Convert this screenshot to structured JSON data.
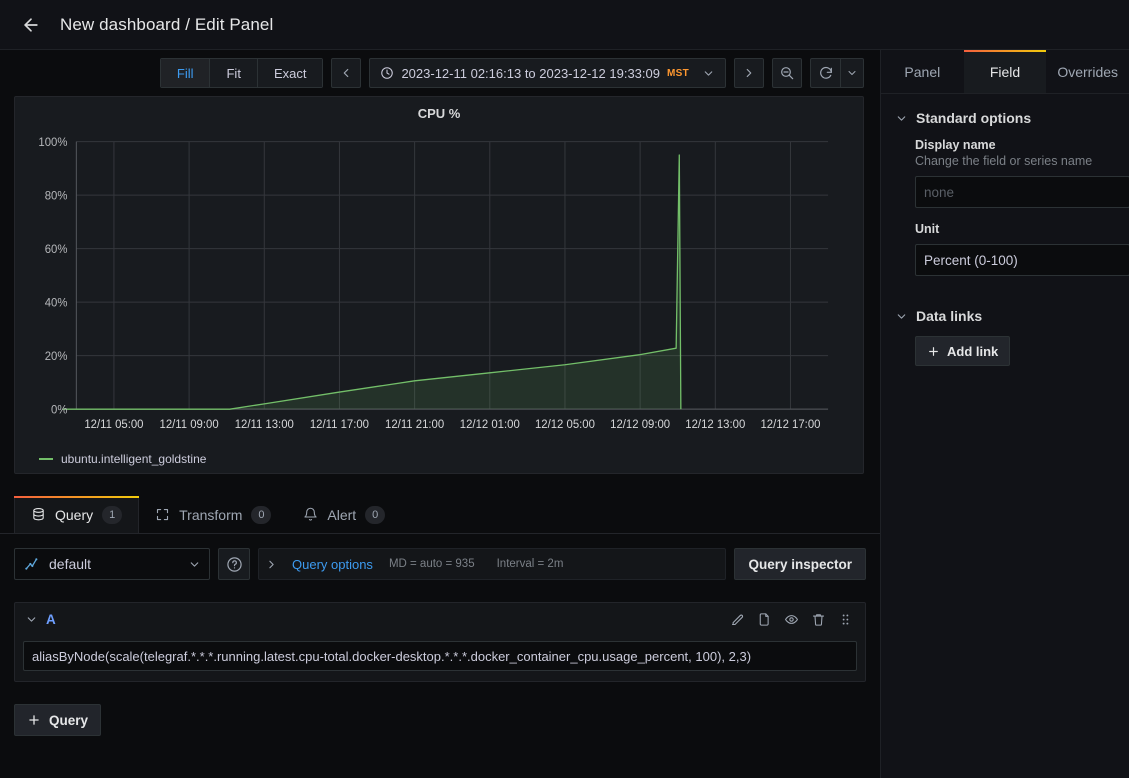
{
  "header": {
    "back_icon": "arrow-left-icon",
    "title": "New dashboard / Edit Panel"
  },
  "toolbar": {
    "sizing_options": [
      {
        "label": "Fill",
        "active": true
      },
      {
        "label": "Fit",
        "active": false
      },
      {
        "label": "Exact",
        "active": false
      }
    ],
    "prev_range_icon": "chevron-left-icon",
    "next_range_icon": "chevron-right-icon",
    "clock_icon": "clock-icon",
    "time_range": "2023-12-11 02:16:13 to 2023-12-12 19:33:09",
    "timezone": "MST",
    "time_caret_icon": "chevron-down-icon",
    "zoom_out_icon": "zoom-out-icon",
    "refresh_icon": "refresh-icon",
    "refresh_caret_icon": "chevron-down-icon"
  },
  "panel": {
    "title": "CPU %",
    "legend": [
      {
        "label": "ubuntu.intelligent_goldstine",
        "color": "#73bf69"
      }
    ]
  },
  "chart_data": {
    "type": "area",
    "title": "CPU %",
    "xlabel": "",
    "ylabel": "",
    "ylim": [
      0,
      100
    ],
    "y_ticks": [
      "0%",
      "20%",
      "40%",
      "60%",
      "80%",
      "100%"
    ],
    "y_tick_values": [
      0,
      20,
      40,
      60,
      80,
      100
    ],
    "x_ticks": [
      "12/11 05:00",
      "12/11 09:00",
      "12/11 13:00",
      "12/11 17:00",
      "12/11 21:00",
      "12/12 01:00",
      "12/12 05:00",
      "12/12 09:00",
      "12/12 13:00",
      "12/12 17:00"
    ],
    "x_range": [
      "2023-12-11 02:16:13",
      "2023-12-12 19:33:09"
    ],
    "grid": true,
    "legend_position": "bottom",
    "series": [
      {
        "name": "ubuntu.intelligent_goldstine",
        "color": "#73bf69",
        "fill": true,
        "x": [
          "12/11 02:16",
          "12/11 10:40",
          "12/11 11:10",
          "12/11 13:00",
          "12/11 17:00",
          "12/11 21:00",
          "12/12 01:00",
          "12/12 05:00",
          "12/12 09:00",
          "12/12 10:55",
          "12/12 11:05",
          "12/12 11:10"
        ],
        "values": [
          0,
          0,
          0,
          2.0,
          6.4,
          10.6,
          13.6,
          16.6,
          20.4,
          22.8,
          95.0,
          0
        ]
      }
    ]
  },
  "tabs": [
    {
      "label": "Query",
      "count": "1",
      "icon": "database-icon",
      "active": true
    },
    {
      "label": "Transform",
      "count": "0",
      "icon": "transform-icon",
      "active": false
    },
    {
      "label": "Alert",
      "count": "0",
      "icon": "bell-icon",
      "active": false
    }
  ],
  "query_editor": {
    "datasource": {
      "name": "default",
      "icon": "graphite-icon",
      "caret_icon": "chevron-down-icon"
    },
    "help_icon": "question-circle-icon",
    "query_options_caret_icon": "chevron-right-icon",
    "query_options_label": "Query options",
    "max_data_points": "MD = auto = 935",
    "interval": "Interval = 2m",
    "query_inspector_label": "Query inspector",
    "queries": [
      {
        "ref_id": "A",
        "collapse_icon": "chevron-down-icon",
        "expression": "aliasByNode(scale(telegraf.*.*.*.running.latest.cpu-total.docker-desktop.*.*.*.docker_container_cpu.usage_percent, 100), 2,3)",
        "actions": [
          {
            "icon": "pencil-icon",
            "name": "edit"
          },
          {
            "icon": "copy-icon",
            "name": "duplicate"
          },
          {
            "icon": "eye-icon",
            "name": "toggle-visibility"
          },
          {
            "icon": "trash-icon",
            "name": "remove"
          },
          {
            "icon": "drag-handle-icon",
            "name": "drag"
          }
        ]
      }
    ],
    "add_query_label": "Query",
    "add_query_icon": "plus-icon"
  },
  "options_pane": {
    "tabs": [
      {
        "label": "Panel",
        "active": false
      },
      {
        "label": "Field",
        "active": true
      },
      {
        "label": "Overrides",
        "active": false
      }
    ],
    "sections": [
      {
        "title": "Standard options",
        "caret_icon": "chevron-down-icon",
        "fields": [
          {
            "label": "Display name",
            "description": "Change the field or series name",
            "type": "input",
            "value": "",
            "placeholder": "none"
          },
          {
            "label": "Unit",
            "type": "select",
            "value": "Percent (0-100)"
          }
        ]
      },
      {
        "title": "Data links",
        "caret_icon": "chevron-down-icon",
        "button": {
          "label": "Add link",
          "icon": "plus-icon"
        }
      }
    ]
  },
  "colors": {
    "accent_blue": "#3d9bf0",
    "series_green": "#73bf69",
    "timezone_orange": "#ff9830",
    "tab_gradient_start": "#f55f3e",
    "tab_gradient_end": "#f2cc0c",
    "panel_bg": "#181b1f",
    "app_bg": "#0b0c0e"
  }
}
